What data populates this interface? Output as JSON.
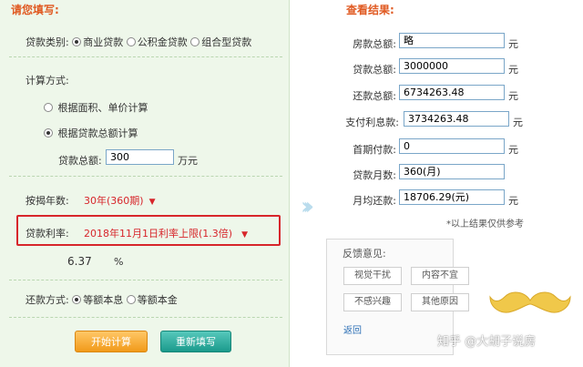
{
  "colors": {
    "left_bg": "#eef7ea",
    "section_title": "#e05a22",
    "red_accent": "#d7262b",
    "start_button": "#f19a1a",
    "reset_button": "#1b9a8c",
    "link": "#2b6fb5"
  },
  "form": {
    "title": "请您填写:",
    "loan_type": {
      "label": "贷款类别:",
      "options": [
        "商业贷款",
        "公积金贷款",
        "组合型贷款"
      ],
      "selected_index": 0
    },
    "calc_method": {
      "label": "计算方式:",
      "options": [
        "根据面积、单价计算",
        "根据贷款总额计算"
      ],
      "selected_index": 1
    },
    "total_loan": {
      "label": "贷款总额:",
      "value": "300",
      "unit": "万元"
    },
    "years": {
      "label": "按揭年数:",
      "value": "30年(360期)"
    },
    "rate": {
      "label": "贷款利率:",
      "value": "2018年11月1日利率上限(1.3倍)",
      "number": "6.37",
      "unit": "%"
    },
    "repay_method": {
      "label": "还款方式:",
      "options": [
        "等额本息",
        "等额本金"
      ],
      "selected_index": 0
    },
    "buttons": {
      "start": "开始计算",
      "reset": "重新填写"
    }
  },
  "results": {
    "title": "查看结果:",
    "rows": [
      {
        "label": "房款总额:",
        "value": "略",
        "unit": "元"
      },
      {
        "label": "贷款总额:",
        "value": "3000000",
        "unit": "元"
      },
      {
        "label": "还款总额:",
        "value": "6734263.48",
        "unit": "元"
      },
      {
        "label": "支付利息款:",
        "value": "3734263.48",
        "unit": "元"
      },
      {
        "label": "首期付款:",
        "value": "0",
        "unit": "元"
      },
      {
        "label": "贷款月数:",
        "value": "360(月)",
        "unit": ""
      },
      {
        "label": "月均还款:",
        "value": "18706.29(元)",
        "unit": "元"
      }
    ],
    "note": "*以上结果仅供参考"
  },
  "feedback": {
    "title": "反馈意见:",
    "options": [
      "视觉干扰",
      "内容不宜",
      "不感兴趣",
      "其他原因"
    ],
    "back": "返回"
  },
  "watermark": {
    "text": "知乎 @大胡子说房"
  },
  "icons": {
    "arrow": "double-chevron-right-icon",
    "caret": "triangle-down-icon",
    "mustache": "mustache-icon"
  }
}
